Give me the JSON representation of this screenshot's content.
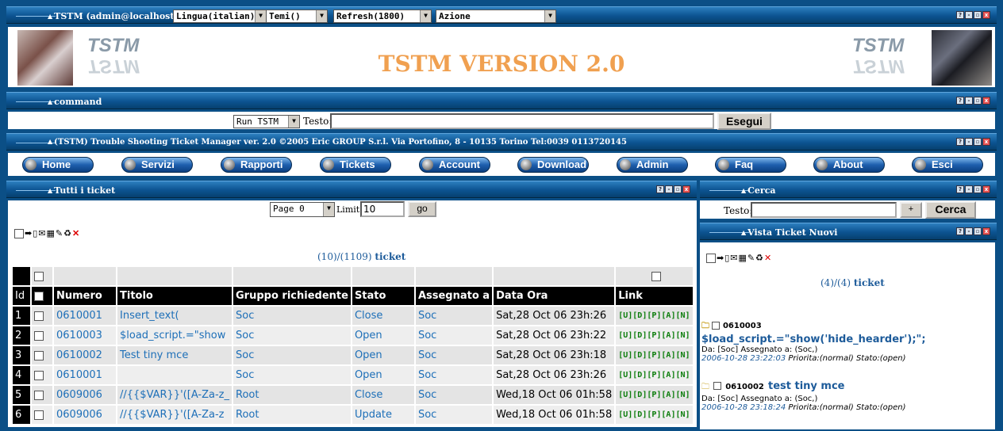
{
  "top": {
    "title": "TSTM (admin@localhost)",
    "lang": "Lingua(italian)",
    "theme": "Temi()",
    "refresh": "Refresh(1800)",
    "action": "Azione"
  },
  "banner": {
    "heading": "TSTM VERSION 2.0",
    "logo_text": "TSTM"
  },
  "command": {
    "title": "command",
    "run_select": "Run TSTM",
    "text_label": "Testo:",
    "exec_label": "Esegui"
  },
  "info": {
    "title": "(TSTM) Trouble Shooting Ticket Manager ver. 2.0 ©2005 Eric GROUP S.r.l. Via Portofino, 8 - 10135 Torino Tel:0039 0113720145"
  },
  "nav": [
    "Home",
    "Servizi",
    "Rapporti",
    "Tickets",
    "Account",
    "Download",
    "Admin",
    "Faq",
    "About",
    "Esci"
  ],
  "tickets": {
    "title": "Tutti i ticket",
    "page_select": "Page 0",
    "limit_label": "Limit:",
    "limit_value": "10",
    "go_label": "go",
    "count": "(10)/(1109)",
    "count_suffix": "ticket",
    "headers": [
      "Id",
      "",
      "Numero",
      "Titolo",
      "Gruppo richiedente",
      "Stato",
      "Assegnato a",
      "Data Ora",
      "Link"
    ],
    "links_label": "[U][D][P][A][N]",
    "rows": [
      {
        "id": "1",
        "num": "0610001",
        "title": "Insert_text(",
        "group": "Soc",
        "state": "Close",
        "assigned": "Soc",
        "date": "Sat,28 Oct 06 23h:26"
      },
      {
        "id": "2",
        "num": "0610003",
        "title": "$load_script.=\"show",
        "group": "Soc",
        "state": "Open",
        "assigned": "Soc",
        "date": "Sat,28 Oct 06 23h:22"
      },
      {
        "id": "3",
        "num": "0610002",
        "title": "Test tiny mce",
        "group": "Soc",
        "state": "Open",
        "assigned": "Soc",
        "date": "Sat,28 Oct 06 23h:18"
      },
      {
        "id": "4",
        "num": "0610001",
        "title": "",
        "group": "Soc",
        "state": "Open",
        "assigned": "Soc",
        "date": "Sat,28 Oct 06 23h:26"
      },
      {
        "id": "5",
        "num": "0609006",
        "title": "//{{$VAR}}'([A-Za-z_",
        "group": "Root",
        "state": "Close",
        "assigned": "Soc",
        "date": "Wed,18 Oct 06 01h:58"
      },
      {
        "id": "6",
        "num": "0609006",
        "title": "//{{$VAR}}'([A-Za-z",
        "group": "Root",
        "state": "Update",
        "assigned": "Soc",
        "date": "Wed,18 Oct 06 01h:58"
      }
    ]
  },
  "cerca": {
    "title": "Cerca",
    "text_label": "Testo:",
    "plus_label": "+",
    "button_label": "Cerca"
  },
  "vista": {
    "title": "Vista Ticket Nuovi",
    "count": "(4)/(4)",
    "count_suffix": "ticket",
    "items": [
      {
        "num": "0610003",
        "title": "$load_script.=\"show('hide_hearder');\";",
        "meta": "Da: [Soc] Assegnato a: (Soc,)",
        "date": "2006-10-28 23:22:03",
        "status": "Priorita:(normal) Stato:(open)"
      },
      {
        "num": "0610002",
        "title": "test tiny mce",
        "meta": "Da: [Soc] Assegnato a: (Soc,)",
        "date": "2006-10-28 23:18:24",
        "status": "Priorita:(normal) Stato:(open)"
      }
    ]
  },
  "colors": {
    "frame": "#0b4f86",
    "heading": "#f0a050",
    "link": "#1d6fb8",
    "links_green": "#0c7d0c"
  }
}
